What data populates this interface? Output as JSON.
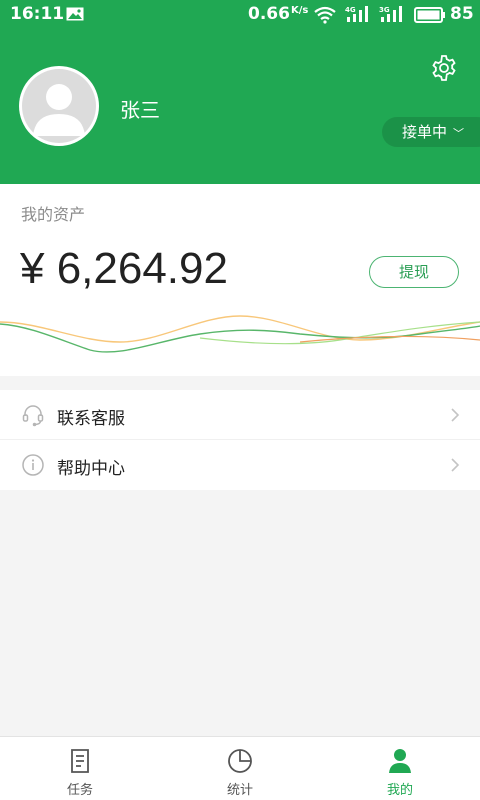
{
  "status_bar": {
    "time": "16:11",
    "net_speed": "0.66",
    "net_speed_unit": "K/s",
    "signal_1_label": "4G",
    "signal_2_label": "3G",
    "battery": "85"
  },
  "profile": {
    "name": "张三",
    "status": "接单中"
  },
  "assets": {
    "label": "我的资产",
    "amount": "¥ 6,264.92",
    "withdraw_label": "提现"
  },
  "menu": {
    "items": [
      {
        "label": "联系客服",
        "icon": "headset-icon"
      },
      {
        "label": "帮助中心",
        "icon": "info-icon"
      }
    ]
  },
  "tabbar": {
    "tabs": [
      {
        "label": "任务",
        "icon": "task-icon",
        "active": false
      },
      {
        "label": "统计",
        "icon": "pie-chart-icon",
        "active": false
      },
      {
        "label": "我的",
        "icon": "person-icon",
        "active": true
      }
    ]
  },
  "colors": {
    "brand_green": "#20a853",
    "page_bg": "#f4f4f4",
    "wave_orange": "#f5a23a",
    "wave_green": "#3ab45a"
  }
}
